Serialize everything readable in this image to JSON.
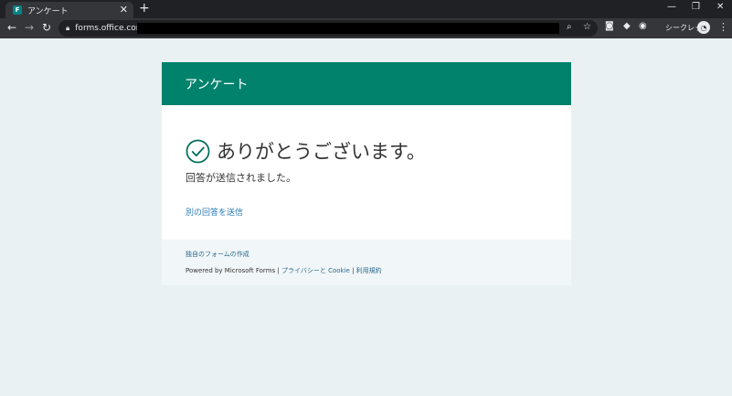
{
  "browser": {
    "tab_title": "アンケート",
    "tab_close": "✕",
    "new_tab": "+",
    "win_minimize": "—",
    "win_restore": "❐",
    "win_close": "✕",
    "url": "forms.office.com/",
    "incognito_label": "シークレット"
  },
  "form": {
    "header_title": "アンケート",
    "thanks_message": "ありがとうございます。",
    "sent_message": "回答が送信されました。",
    "resubmit_link": "別の回答を送信"
  },
  "footer": {
    "create_form_link": "独自のフォームの作成",
    "powered_by": "Powered by Microsoft Forms |",
    "privacy_link": "プライバシーと Cookie",
    "separator": "|",
    "terms_link": "利用規約"
  },
  "colors": {
    "header_green": "#00826c",
    "check_teal": "#006e5c",
    "link_blue": "#2b7bb9",
    "page_bg": "#eaf1f3"
  }
}
